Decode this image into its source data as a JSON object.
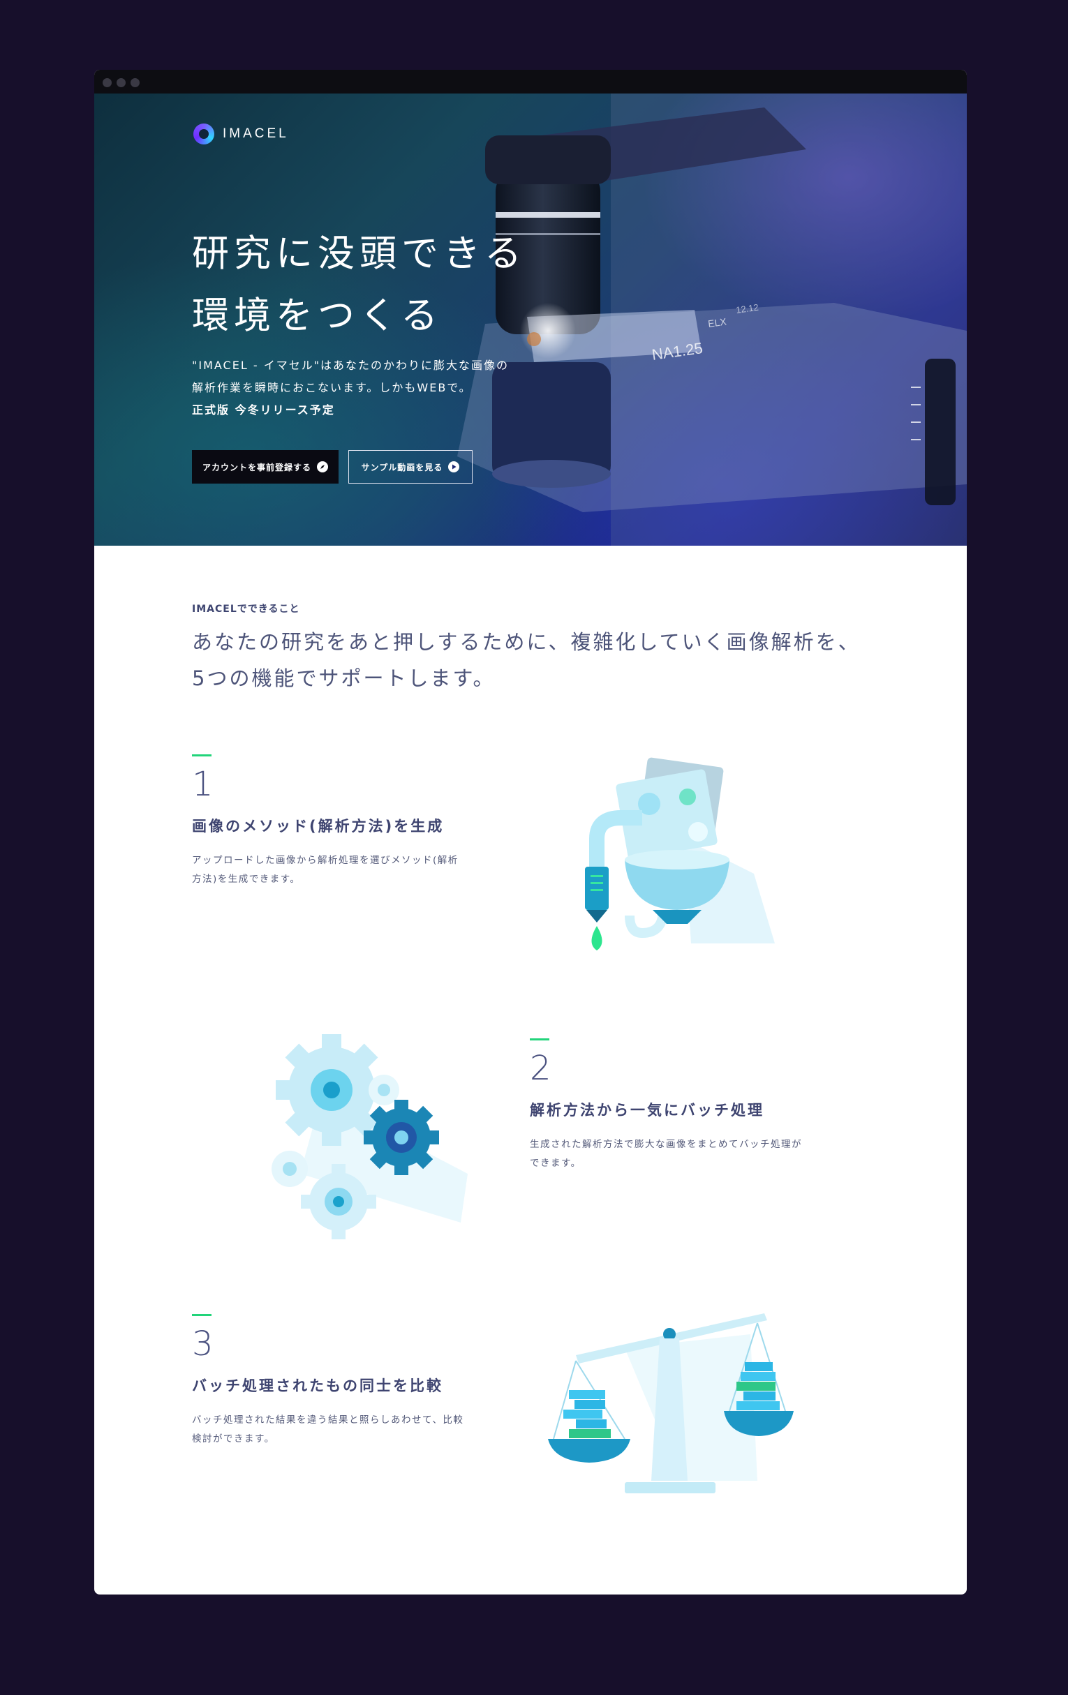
{
  "brand": {
    "name": "IMACEL"
  },
  "hero": {
    "title_lines": [
      "研究に没頭できる",
      "環境をつくる"
    ],
    "desc_lines": [
      "\"IMACEL - イマセル\"はあなたのかわりに膨大な画像の",
      "解析作業を瞬時におこないます。しかもWEBで。",
      "正式版 今冬リリース予定"
    ],
    "primary_button": "アカウントを事前登録する",
    "secondary_button": "サンプル動画を見る",
    "scene_labels": [
      "NA1.25",
      "ELX",
      "12.12"
    ]
  },
  "about": {
    "label": "IMACELでできること",
    "lead_lines": [
      "あなたの研究をあと押しするために、複雑化していく画像解析を、",
      "5つの機能でサポートします。"
    ]
  },
  "features": [
    {
      "num": "1",
      "title": "画像のメソッド(解析方法)を生成",
      "desc_lines": [
        "アップロードした画像から解析処理を選びメソッド(解析",
        "方法)を生成できます。"
      ]
    },
    {
      "num": "2",
      "title": "解析方法から一気にバッチ処理",
      "desc_lines": [
        "生成された解析方法で膨大な画像をまとめてバッチ処理が",
        "できます。"
      ]
    },
    {
      "num": "3",
      "title": "バッチ処理されたもの同士を比較",
      "desc_lines": [
        "バッチ処理された結果を違う結果と照らしあわせて、比較",
        "検討ができます。"
      ]
    }
  ],
  "colors": {
    "background": "#170f2b",
    "accent": "#22d47a",
    "text": "#3e4470",
    "illustration": "#3bc7ea"
  },
  "icons": {
    "primary_button": "compass-icon",
    "secondary_button": "play-icon"
  }
}
